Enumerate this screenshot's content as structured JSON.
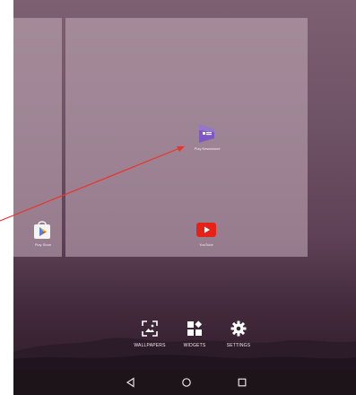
{
  "apps": {
    "news": {
      "label": "Play Newsstand",
      "icon": "play-newsstand-icon",
      "color": "#7e57c2"
    },
    "playstore": {
      "label": "Play Store",
      "icon": "play-store-icon"
    },
    "youtube": {
      "label": "YouTube",
      "icon": "youtube-icon",
      "color": "#e62117"
    }
  },
  "overview": {
    "wallpapers_label": "WALLPAPERS",
    "widgets_label": "WIDGETS",
    "settings_label": "SETTINGS"
  },
  "navbar": {
    "back_icon": "back-triangle-icon",
    "home_icon": "home-circle-icon",
    "recents_icon": "recents-square-icon"
  },
  "annotation": {
    "arrow_color": "#e8362a"
  }
}
